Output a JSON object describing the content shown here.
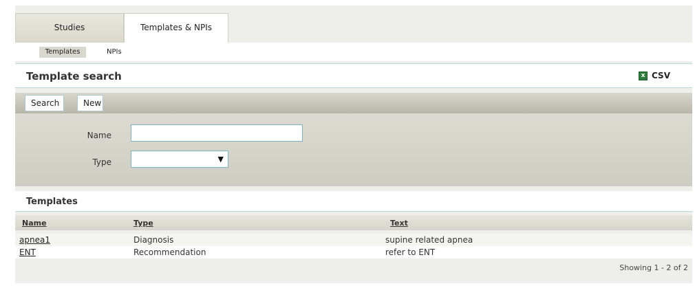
{
  "tabs": [
    {
      "label": "Studies",
      "active": false
    },
    {
      "label": "Templates & NPIs",
      "active": true
    }
  ],
  "subtabs": [
    {
      "label": "Templates",
      "active": true
    },
    {
      "label": "NPIs",
      "active": false
    }
  ],
  "search_panel": {
    "title": "Template search",
    "csv_label": "CSV",
    "csv_icon": "excel-icon"
  },
  "toolbar": {
    "search_label": "Search",
    "new_label": "New"
  },
  "form": {
    "name_label": "Name",
    "name_value": "",
    "type_label": "Type",
    "type_value": ""
  },
  "results": {
    "title": "Templates",
    "columns": [
      "Name",
      "Type",
      "Text"
    ],
    "rows": [
      {
        "name": "apnea1",
        "type": "Diagnosis",
        "text": "supine related apnea"
      },
      {
        "name": "ENT",
        "type": "Recommendation",
        "text": "refer to ENT"
      }
    ],
    "showing": "Showing 1 - 2 of 2"
  },
  "colors": {
    "accent_border": "#7fb3c4",
    "toolbar_bg": "#b8b6a8",
    "panel_bg": "#eeeeea",
    "csv_icon_color": "#2f7d3d"
  }
}
